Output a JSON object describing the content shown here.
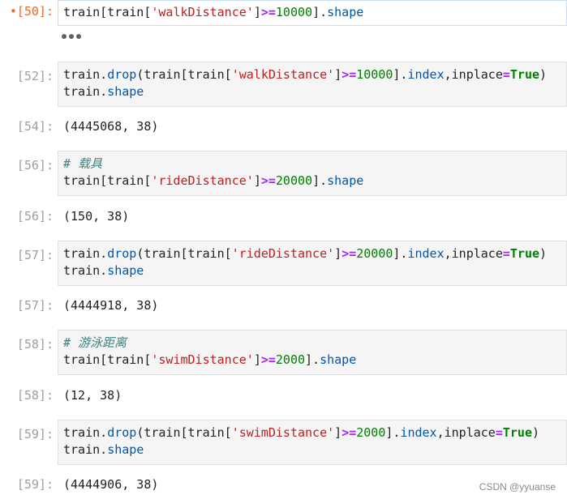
{
  "cells": [
    {
      "prompt": "•[50]:",
      "code": [
        [
          {
            "t": "train[train[",
            "c": ""
          },
          {
            "t": "'walkDistance'",
            "c": "str"
          },
          {
            "t": "]",
            "c": ""
          },
          {
            "t": ">=",
            "c": "op"
          },
          {
            "t": "10000",
            "c": "num"
          },
          {
            "t": "].",
            "c": ""
          },
          {
            "t": "shape",
            "c": "attr"
          }
        ]
      ],
      "output_collapsed_icon": "ellipsis-icon"
    },
    {
      "prompt": "[52]:",
      "code": [
        [
          {
            "t": "train.",
            "c": ""
          },
          {
            "t": "drop",
            "c": "attr"
          },
          {
            "t": "(train[train[",
            "c": ""
          },
          {
            "t": "'walkDistance'",
            "c": "str"
          },
          {
            "t": "]",
            "c": ""
          },
          {
            "t": ">=",
            "c": "op"
          },
          {
            "t": "10000",
            "c": "num"
          },
          {
            "t": "].",
            "c": ""
          },
          {
            "t": "index",
            "c": "attr"
          },
          {
            "t": ",inplace",
            "c": ""
          },
          {
            "t": "=",
            "c": "op"
          },
          {
            "t": "True",
            "c": "kw"
          },
          {
            "t": ")",
            "c": ""
          }
        ],
        [
          {
            "t": "train.",
            "c": ""
          },
          {
            "t": "shape",
            "c": "attr"
          }
        ]
      ],
      "output_prompt": "[54]:",
      "output": "(4445068, 38)"
    },
    {
      "prompt": "[56]:",
      "code": [
        [
          {
            "t": "# 载具",
            "c": "cm"
          }
        ],
        [
          {
            "t": "train[train[",
            "c": ""
          },
          {
            "t": "'rideDistance'",
            "c": "str"
          },
          {
            "t": "]",
            "c": ""
          },
          {
            "t": ">=",
            "c": "op"
          },
          {
            "t": "20000",
            "c": "num"
          },
          {
            "t": "].",
            "c": ""
          },
          {
            "t": "shape",
            "c": "attr"
          }
        ]
      ],
      "output_prompt": "[56]:",
      "output": "(150, 38)"
    },
    {
      "prompt": "[57]:",
      "code": [
        [
          {
            "t": "train.",
            "c": ""
          },
          {
            "t": "drop",
            "c": "attr"
          },
          {
            "t": "(train[train[",
            "c": ""
          },
          {
            "t": "'rideDistance'",
            "c": "str"
          },
          {
            "t": "]",
            "c": ""
          },
          {
            "t": ">=",
            "c": "op"
          },
          {
            "t": "20000",
            "c": "num"
          },
          {
            "t": "].",
            "c": ""
          },
          {
            "t": "index",
            "c": "attr"
          },
          {
            "t": ",inplace",
            "c": ""
          },
          {
            "t": "=",
            "c": "op"
          },
          {
            "t": "True",
            "c": "kw"
          },
          {
            "t": ")",
            "c": ""
          }
        ],
        [
          {
            "t": "train.",
            "c": ""
          },
          {
            "t": "shape",
            "c": "attr"
          }
        ]
      ],
      "output_prompt": "[57]:",
      "output": "(4444918, 38)"
    },
    {
      "prompt": "[58]:",
      "code": [
        [
          {
            "t": "# 游泳距离",
            "c": "cm"
          }
        ],
        [
          {
            "t": "train[train[",
            "c": ""
          },
          {
            "t": "'swimDistance'",
            "c": "str"
          },
          {
            "t": "]",
            "c": ""
          },
          {
            "t": ">=",
            "c": "op"
          },
          {
            "t": "2000",
            "c": "num"
          },
          {
            "t": "].",
            "c": ""
          },
          {
            "t": "shape",
            "c": "attr"
          }
        ]
      ],
      "output_prompt": "[58]:",
      "output": "(12, 38)"
    },
    {
      "prompt": "[59]:",
      "code": [
        [
          {
            "t": "train.",
            "c": ""
          },
          {
            "t": "drop",
            "c": "attr"
          },
          {
            "t": "(train[train[",
            "c": ""
          },
          {
            "t": "'swimDistance'",
            "c": "str"
          },
          {
            "t": "]",
            "c": ""
          },
          {
            "t": ">=",
            "c": "op"
          },
          {
            "t": "2000",
            "c": "num"
          },
          {
            "t": "].",
            "c": ""
          },
          {
            "t": "index",
            "c": "attr"
          },
          {
            "t": ",inplace",
            "c": ""
          },
          {
            "t": "=",
            "c": "op"
          },
          {
            "t": "True",
            "c": "kw"
          },
          {
            "t": ")",
            "c": ""
          }
        ],
        [
          {
            "t": "train.",
            "c": ""
          },
          {
            "t": "shape",
            "c": "attr"
          }
        ]
      ],
      "output_prompt": "[59]:",
      "output": "(4444906, 38)"
    }
  ],
  "watermark": "CSDN @yyuanse",
  "colors": {
    "string": "#ba2121",
    "operator": "#aa22ff",
    "number": "#008000",
    "attribute": "#0055aa",
    "keyword": "#008000",
    "comment": "#408080",
    "active_prompt": "#e66c2c",
    "prompt": "#9e9e9e"
  }
}
